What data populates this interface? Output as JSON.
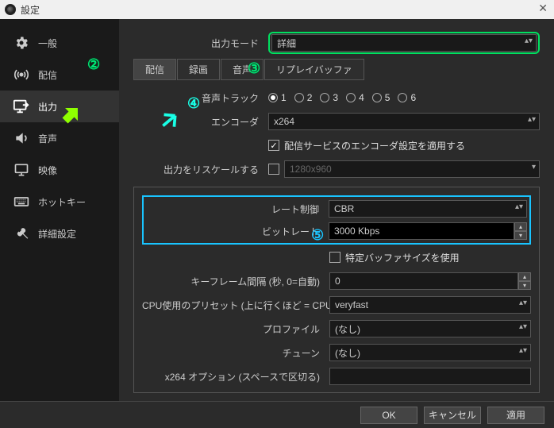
{
  "window": {
    "title": "設定"
  },
  "sidebar": {
    "items": [
      {
        "label": "一般"
      },
      {
        "label": "配信"
      },
      {
        "label": "出力"
      },
      {
        "label": "音声"
      },
      {
        "label": "映像"
      },
      {
        "label": "ホットキー"
      },
      {
        "label": "詳細設定"
      }
    ]
  },
  "annotations": {
    "n2": "②",
    "n3": "③",
    "n4": "④",
    "n5": "⑤"
  },
  "output": {
    "mode_label": "出力モード",
    "mode_value": "詳細",
    "tabs": {
      "stream": "配信",
      "record": "録画",
      "audio": "音声",
      "replay": "リプレイバッファ"
    },
    "audio_track_label": "音声トラック",
    "tracks": [
      "1",
      "2",
      "3",
      "4",
      "5",
      "6"
    ],
    "encoder_label": "エンコーダ",
    "encoder_value": "x264",
    "apply_service_label": "配信サービスのエンコーダ設定を適用する",
    "rescale_label": "出力をリスケールする",
    "rescale_value": "1280x960",
    "rate_control_label": "レート制御",
    "rate_control_value": "CBR",
    "bitrate_label": "ビットレート",
    "bitrate_value": "3000 Kbps",
    "custom_buffer_label": "特定バッファサイズを使用",
    "keyframe_label": "キーフレーム間隔 (秒, 0=自動)",
    "keyframe_value": "0",
    "cpu_preset_label": "CPU使用のプリセット (上に行くほど = CPU使用低い)",
    "cpu_preset_value": "veryfast",
    "profile_label": "プロファイル",
    "profile_value": "(なし)",
    "tune_label": "チューン",
    "tune_value": "(なし)",
    "x264_opts_label": "x264 オプション (スペースで区切る)"
  },
  "footer": {
    "ok": "OK",
    "cancel": "キャンセル",
    "apply": "適用"
  }
}
